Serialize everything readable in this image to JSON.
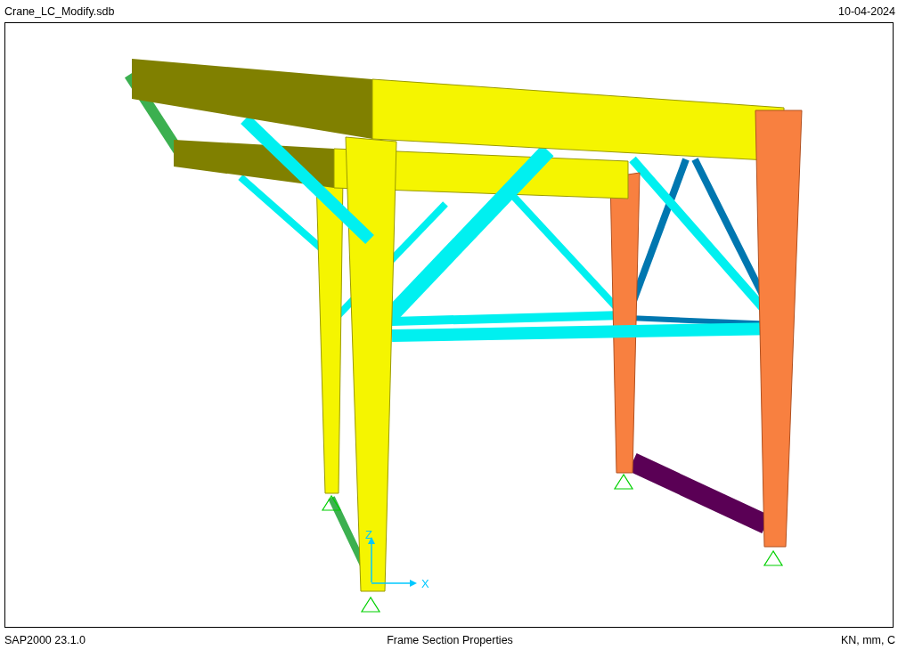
{
  "header": {
    "file_name": "Crane_LC_Modify.sdb",
    "date": "10-04-2024"
  },
  "axes": {
    "z_label": "Z",
    "x_label": "X"
  },
  "footer": {
    "program": "SAP2000 23.1.0",
    "title": "Frame Section Properties",
    "units": "KN, mm, C"
  }
}
